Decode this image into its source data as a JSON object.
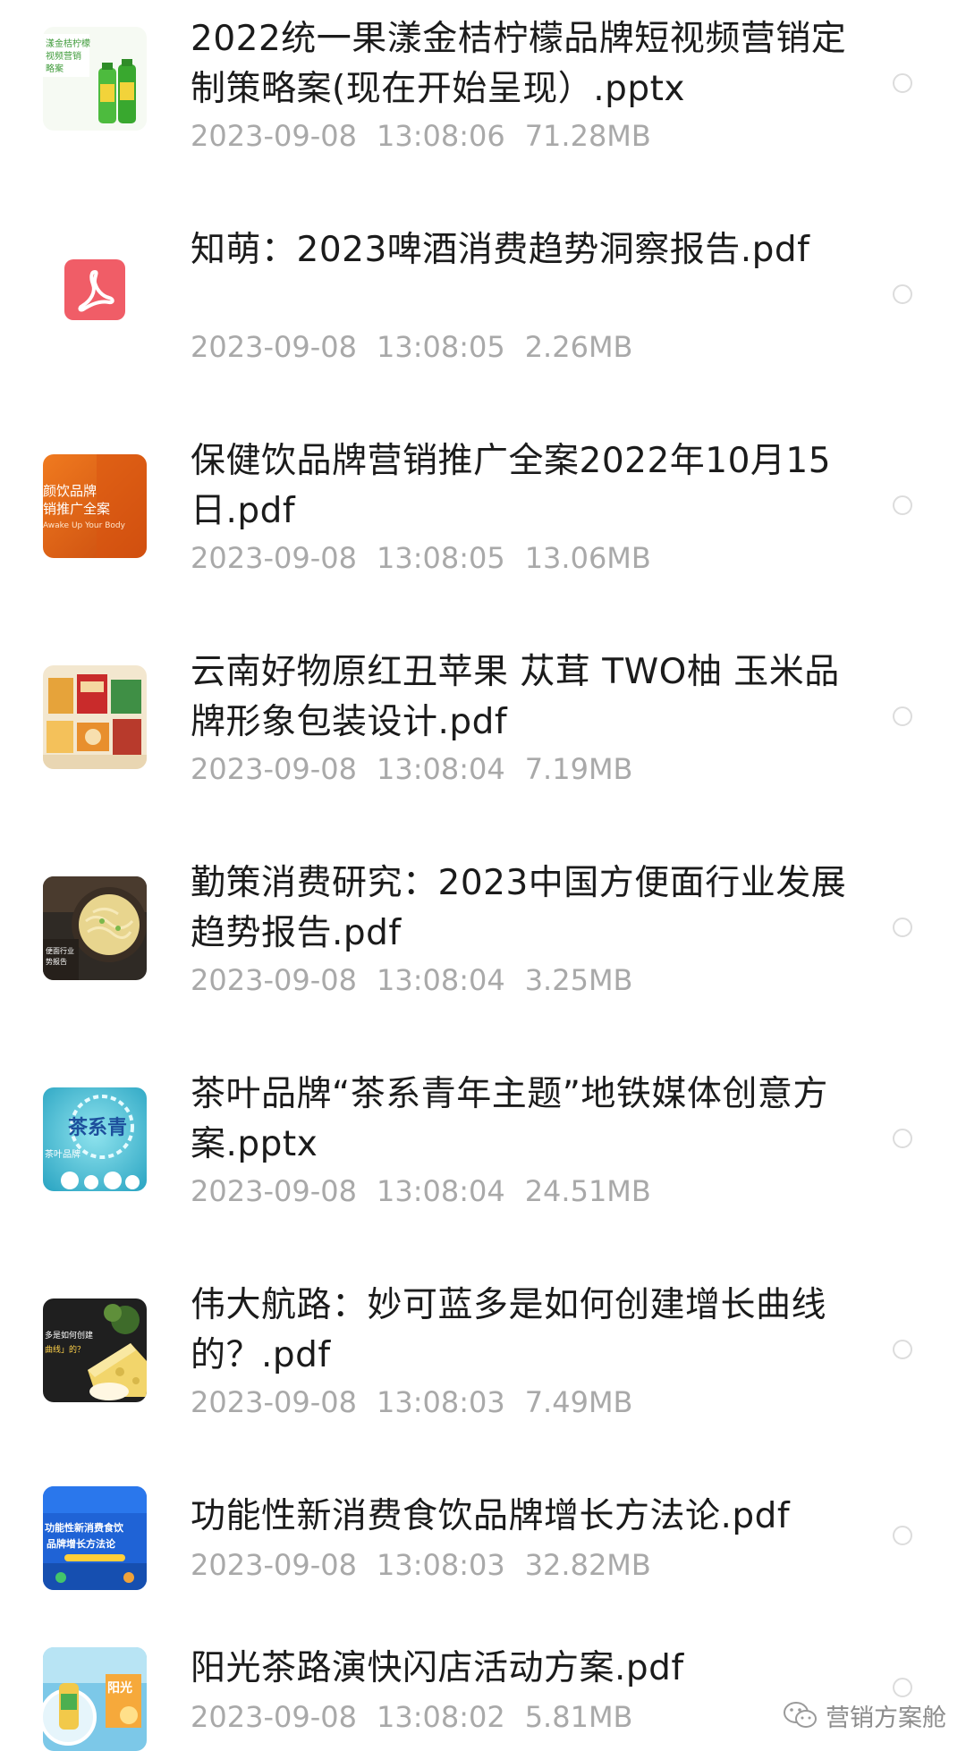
{
  "files": [
    {
      "name": "2022统一果漾金桔柠檬品牌短视频营销定制策略案(现在开始呈现）.pptx",
      "date": "2023-09-08",
      "time": "13:08:06",
      "size": "71.28MB",
      "thumbnail_icon": "green-bottles-thumbnail",
      "thumbnail_text": "漾金桔柠檬 视频营销 略案"
    },
    {
      "name": "知萌：2023啤酒消费趋势洞察报告.pdf",
      "date": "2023-09-08",
      "time": "13:08:05",
      "size": "2.26MB",
      "thumbnail_icon": "pdf-icon"
    },
    {
      "name": "保健饮品牌营销推广全案2022年10月15日.pdf",
      "date": "2023-09-08",
      "time": "13:08:05",
      "size": "13.06MB",
      "thumbnail_icon": "orange-cover-thumbnail",
      "thumbnail_text": "饮品牌 销推广全案"
    },
    {
      "name": "云南好物原红丑苹果 苁茸 TWO柚 玉米品牌形象包装设计.pdf",
      "date": "2023-09-08",
      "time": "13:08:04",
      "size": "7.19MB",
      "thumbnail_icon": "packaging-thumbnail"
    },
    {
      "name": "勤策消费研究：2023中国方便面行业发展趋势报告.pdf",
      "date": "2023-09-08",
      "time": "13:08:04",
      "size": "3.25MB",
      "thumbnail_icon": "noodle-bowl-thumbnail"
    },
    {
      "name": "茶叶品牌“茶系青年主题”地铁媒体创意方案.pptx",
      "date": "2023-09-08",
      "time": "13:08:04",
      "size": "24.51MB",
      "thumbnail_icon": "tea-theme-thumbnail",
      "thumbnail_text": "茶系青"
    },
    {
      "name": "伟大航路：妙可蓝多是如何创建增长曲线的？.pdf",
      "date": "2023-09-08",
      "time": "13:08:03",
      "size": "7.49MB",
      "thumbnail_icon": "cheese-thumbnail",
      "thumbnail_text": "多是如何创建 曲线 的？"
    },
    {
      "name": "功能性新消费食饮品牌增长方法论.pdf",
      "date": "2023-09-08",
      "time": "13:08:03",
      "size": "32.82MB",
      "thumbnail_icon": "blue-banner-thumbnail",
      "thumbnail_text": "功能性新消费食饮 品牌增长方法论"
    },
    {
      "name": "阳光茶路演快闪店活动方案.pdf",
      "date": "2023-09-08",
      "time": "13:08:02",
      "size": "5.81MB",
      "thumbnail_icon": "sunshine-tea-thumbnail",
      "thumbnail_text": "阳光"
    }
  ],
  "watermark": {
    "text": "营销方案舱",
    "icon": "wechat-logo-icon"
  }
}
